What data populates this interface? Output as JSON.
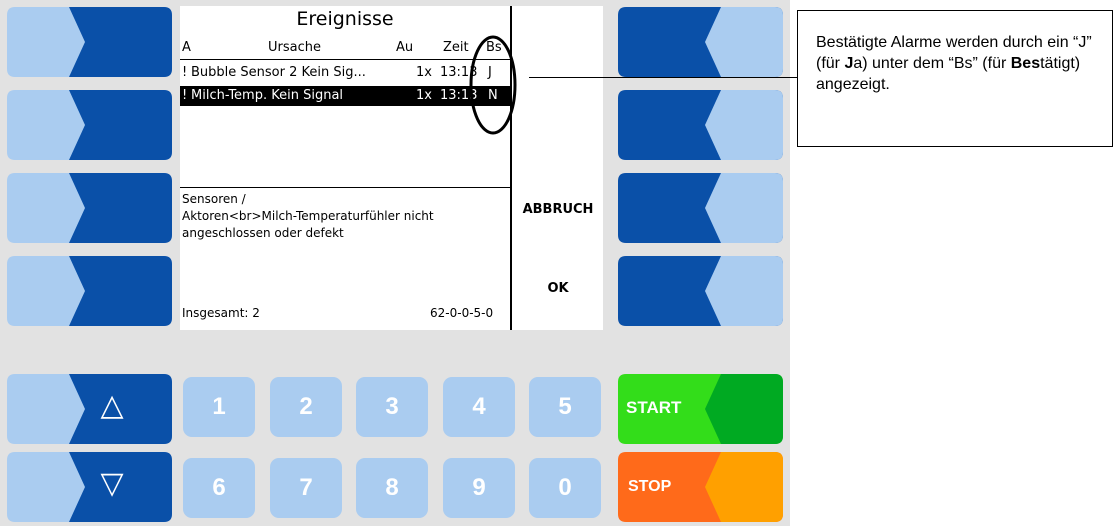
{
  "screen": {
    "title": "Ereignisse",
    "columns": {
      "a": "A",
      "ursache": "Ursache",
      "au": "Au",
      "zeit": "Zeit",
      "bs": "Bs"
    },
    "rows": [
      {
        "a": "!",
        "ursache": "Bubble Sensor 2 Kein Sig...",
        "au": "1x",
        "zeit": "13:13",
        "bs": "J",
        "selected": false
      },
      {
        "a": "!",
        "ursache": "Milch-Temp. Kein Signal",
        "au": "1x",
        "zeit": "13:13",
        "bs": "N",
        "selected": true
      }
    ],
    "detail_line1": "Sensoren /",
    "detail_line2": "Aktoren<br>Milch-Temperaturfühler nicht",
    "detail_line3": "angeschlossen oder defekt",
    "total_label": "Insgesamt: 2",
    "code": "62-0-0-5-0",
    "abbruch_label": "ABBRUCH",
    "ok_label": "OK"
  },
  "keypad": {
    "up_icon": "triangle-up-icon",
    "down_icon": "triangle-down-icon",
    "up_symbol": "△",
    "down_symbol": "▽",
    "numbers_top": [
      "1",
      "2",
      "3",
      "4",
      "5"
    ],
    "numbers_bottom": [
      "6",
      "7",
      "8",
      "9",
      "0"
    ],
    "start_label": "START",
    "stop_label": "STOP"
  },
  "colors": {
    "key_dark_blue": "#0a50a8",
    "key_light_blue": "#aaccf0",
    "start_green": "#33dd1a",
    "start_green_dark": "#00aa22",
    "stop_orange": "#ff6a1a",
    "stop_orange_light": "#ffa000"
  },
  "callout": {
    "part1": "Bestätigte Alarme werden durch ein “J” (für ",
    "part2_bold": "J",
    "part3": "a) unter dem “Bs” (für ",
    "part4_bold": "Bes",
    "part5": "tätigt) angezeigt."
  }
}
